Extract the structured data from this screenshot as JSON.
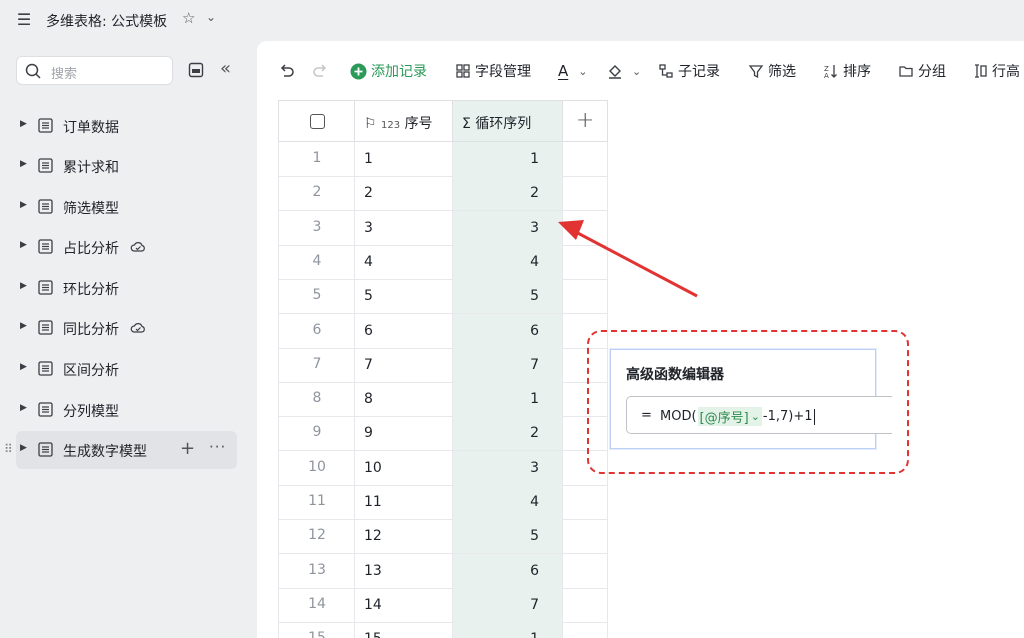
{
  "topbar": {
    "title": "多维表格: 公式模板",
    "menu_icon": "hamburger-icon",
    "star_icon": "star-icon",
    "caret_icon": "chevron-down-icon"
  },
  "sidebar": {
    "search_placeholder": "搜索",
    "items": [
      {
        "label": "订单数据"
      },
      {
        "label": "累计求和"
      },
      {
        "label": "筛选模型"
      },
      {
        "label": "占比分析",
        "cloud": true
      },
      {
        "label": "环比分析"
      },
      {
        "label": "同比分析",
        "cloud": true
      },
      {
        "label": "区间分析"
      },
      {
        "label": "分列模型"
      },
      {
        "label": "生成数字模型",
        "active": true
      }
    ]
  },
  "toolbar": {
    "add_record": "添加记录",
    "field_manage": "字段管理",
    "text_a": "A",
    "sub_record": "子记录",
    "filter": "筛选",
    "sort": "排序",
    "group": "分组",
    "row_height": "行高",
    "accent_color": "#2b9958"
  },
  "table": {
    "col_seq_badge": "123",
    "col_seq": "序号",
    "col_loop_badge": "Σ",
    "col_loop": "循环序列",
    "rows": [
      {
        "idx": "1",
        "seq": "1",
        "loop": "1"
      },
      {
        "idx": "2",
        "seq": "2",
        "loop": "2"
      },
      {
        "idx": "3",
        "seq": "3",
        "loop": "3"
      },
      {
        "idx": "4",
        "seq": "4",
        "loop": "4"
      },
      {
        "idx": "5",
        "seq": "5",
        "loop": "5"
      },
      {
        "idx": "6",
        "seq": "6",
        "loop": "6"
      },
      {
        "idx": "7",
        "seq": "7",
        "loop": "7"
      },
      {
        "idx": "8",
        "seq": "8",
        "loop": "1"
      },
      {
        "idx": "9",
        "seq": "9",
        "loop": "2"
      },
      {
        "idx": "10",
        "seq": "10",
        "loop": "3"
      },
      {
        "idx": "11",
        "seq": "11",
        "loop": "4"
      },
      {
        "idx": "12",
        "seq": "12",
        "loop": "5"
      },
      {
        "idx": "13",
        "seq": "13",
        "loop": "6"
      },
      {
        "idx": "14",
        "seq": "14",
        "loop": "7"
      },
      {
        "idx": "15",
        "seq": "15",
        "loop": "1"
      }
    ]
  },
  "editor": {
    "title": "高级函数编辑器",
    "eq": "=",
    "formula_pre": "MOD(",
    "formula_ref": "[@序号]",
    "formula_post": "-1,7)+1"
  },
  "annotation_color": "#e23333"
}
